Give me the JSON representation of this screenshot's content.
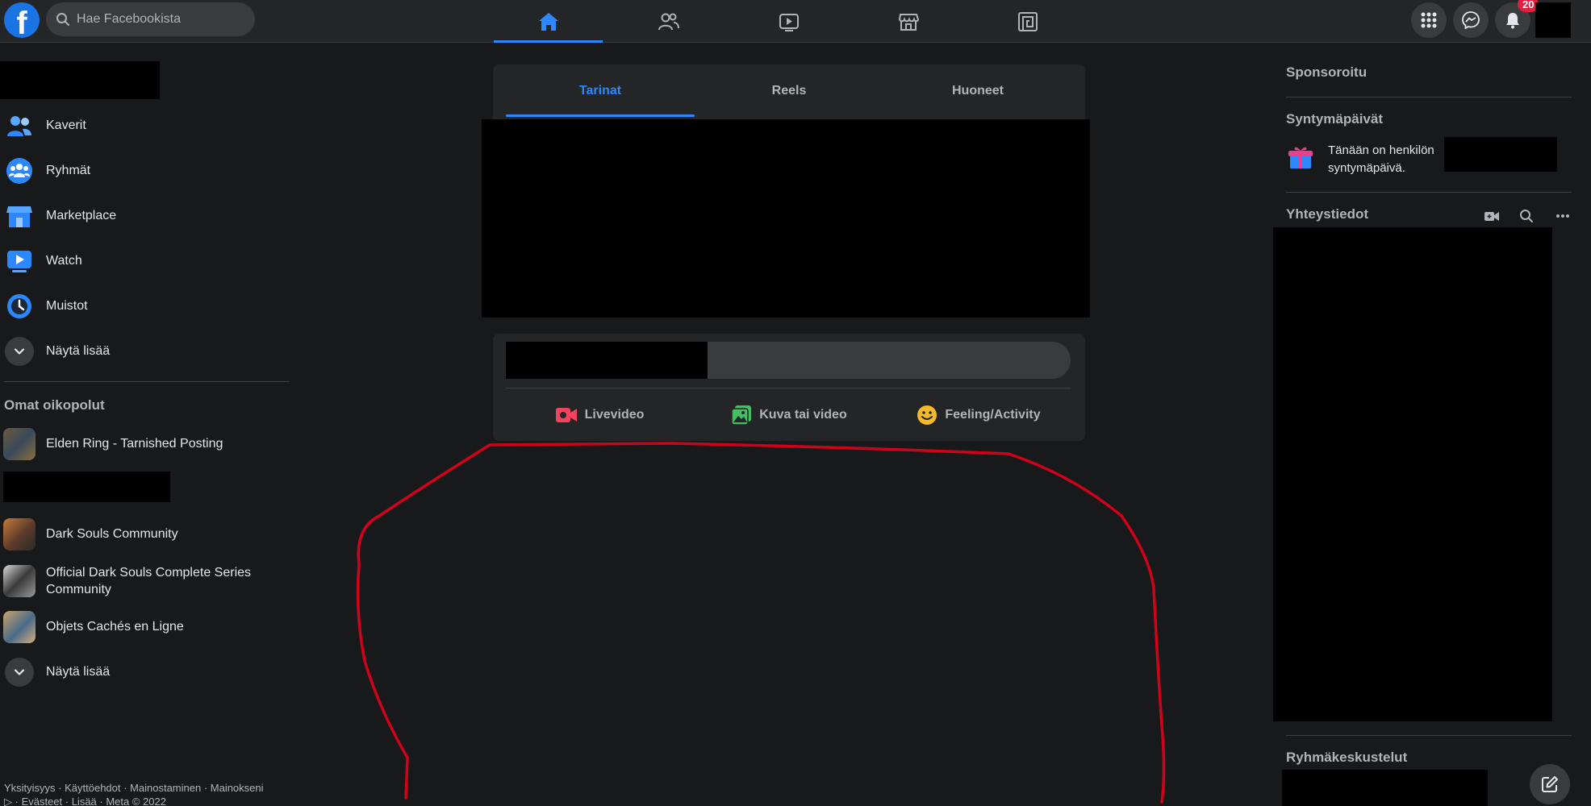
{
  "topbar": {
    "logo": "f",
    "search_placeholder": "Hae Facebookista",
    "nav_icons": [
      "home-icon",
      "friends-icon",
      "watch-icon",
      "marketplace-icon",
      "gaming-icon"
    ],
    "notifications_count": "20"
  },
  "sidebar": {
    "items": [
      {
        "label": "Kaverit",
        "icon": "friends-icon"
      },
      {
        "label": "Ryhmät",
        "icon": "groups-icon"
      },
      {
        "label": "Marketplace",
        "icon": "marketplace-icon"
      },
      {
        "label": "Watch",
        "icon": "watch-icon"
      },
      {
        "label": "Muistot",
        "icon": "memories-icon"
      },
      {
        "label": "Näytä lisää",
        "icon": "chevron-down-icon"
      }
    ],
    "shortcuts_title": "Omat oikopolut",
    "shortcuts": [
      {
        "label": "Elden Ring - Tarnished Posting"
      },
      {
        "label": "Dark Souls Community"
      },
      {
        "label": "Official Dark Souls Complete Series Community"
      },
      {
        "label": "Objets Cachés en Ligne"
      },
      {
        "label": "Näytä lisää"
      }
    ],
    "footer_line1": "Yksityisyys · Käyttöehdot · Mainostaminen · Mainokseni",
    "footer_line2": "· Evästeet · Lisää · Meta © 2022"
  },
  "stories": {
    "tabs": [
      "Tarinat",
      "Reels",
      "Huoneet"
    ]
  },
  "composer": {
    "actions": [
      {
        "label": "Livevideo",
        "icon": "live-video-icon"
      },
      {
        "label": "Kuva tai video",
        "icon": "photo-video-icon"
      },
      {
        "label": "Feeling/Activity",
        "icon": "feeling-icon"
      }
    ]
  },
  "right": {
    "sponsored_title": "Sponsoroitu",
    "birthdays_title": "Syntymäpäivät",
    "birthday_text": "Tänään on henkilön",
    "birthday_text_2": "syntymäpäivä.",
    "contacts_title": "Yhteystiedot",
    "group_chats_title": "Ryhmäkeskustelut"
  },
  "colors": {
    "background": "#18191a",
    "surface": "#242526",
    "accent": "#2d88ff",
    "annotation": "#d0021b"
  }
}
